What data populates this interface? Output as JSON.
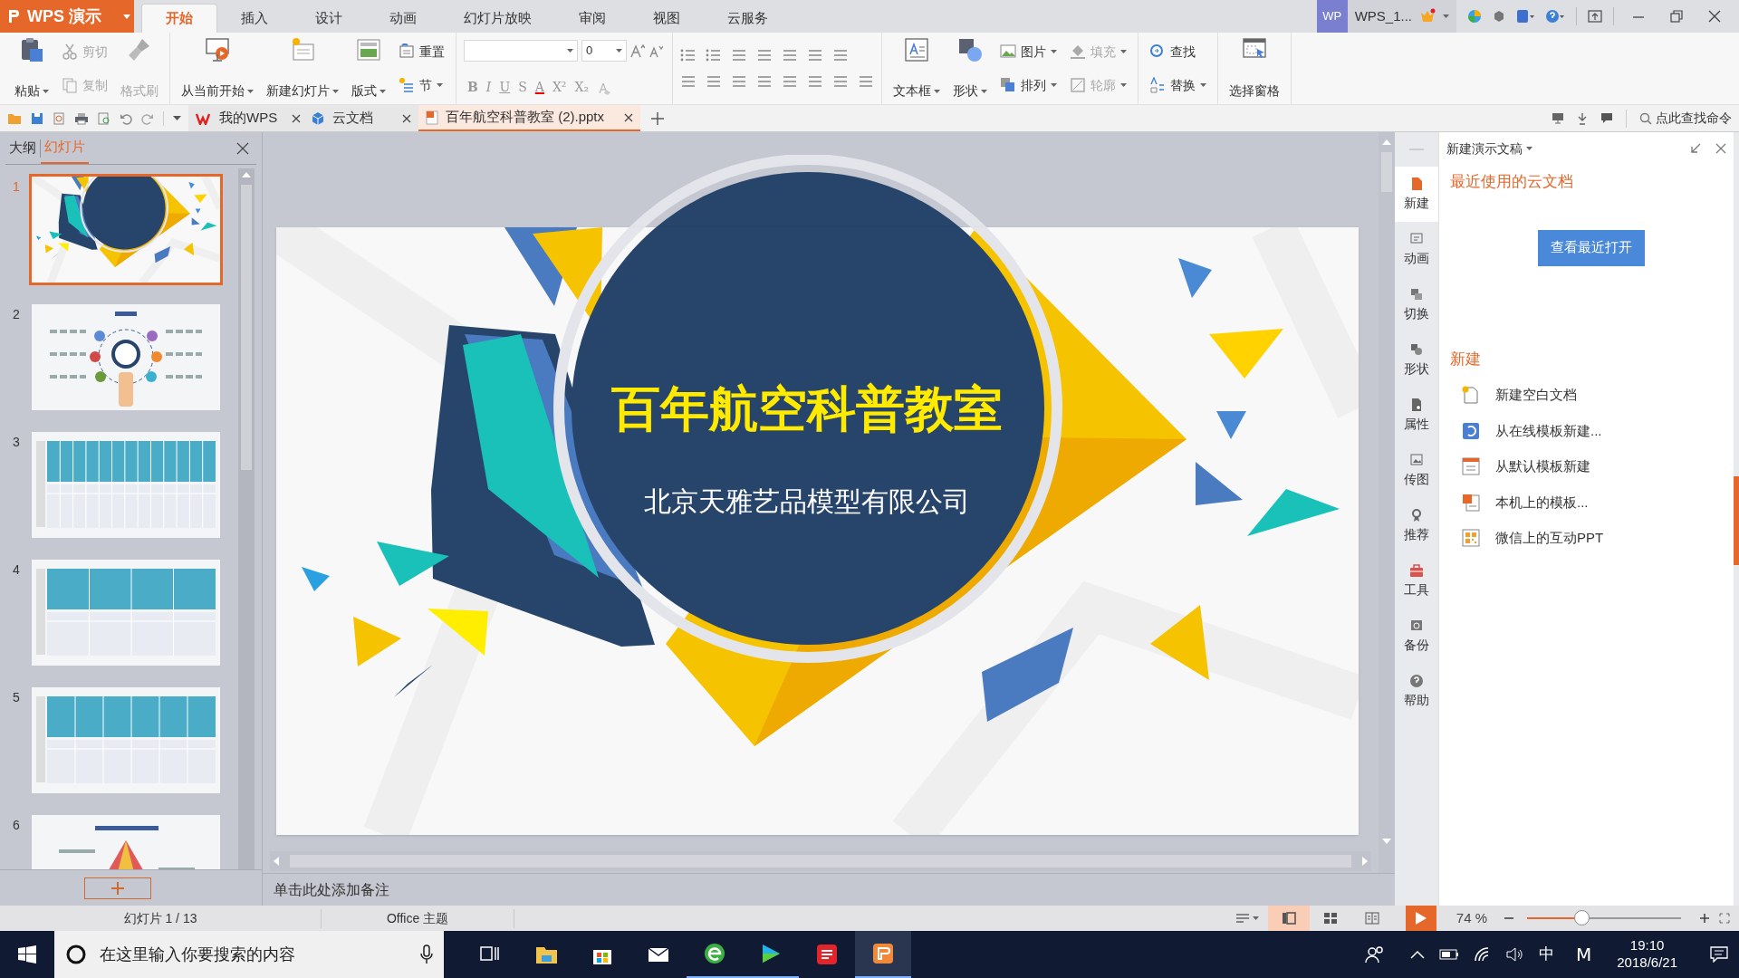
{
  "app": {
    "logo": "WPS 演示",
    "avatar": "WP",
    "account": "WPS_1..."
  },
  "ribbon_tabs": [
    {
      "label": "开始",
      "selected": true
    },
    {
      "label": "插入",
      "selected": false
    },
    {
      "label": "设计",
      "selected": false
    },
    {
      "label": "动画",
      "selected": false
    },
    {
      "label": "幻灯片放映",
      "selected": false
    },
    {
      "label": "审阅",
      "selected": false
    },
    {
      "label": "视图",
      "selected": false
    },
    {
      "label": "云服务",
      "selected": false
    }
  ],
  "ribbon_groups": [
    {
      "kind": "buttons",
      "columns": [
        [
          {
            "kind": "large",
            "label": "粘贴",
            "dropdown": true,
            "disabled": false
          }
        ],
        [
          {
            "kind": "small",
            "label": "剪切",
            "dropdown": false,
            "disabled": true
          },
          {
            "kind": "small",
            "label": "复制",
            "dropdown": false,
            "disabled": true
          }
        ],
        [
          {
            "kind": "large",
            "label": "格式刷",
            "dropdown": false,
            "disabled": true
          }
        ]
      ]
    },
    {
      "kind": "buttons",
      "columns": [
        [
          {
            "kind": "large",
            "label": "从当前开始",
            "dropdown": true,
            "disabled": false
          }
        ],
        [
          {
            "kind": "large",
            "label": "新建幻灯片",
            "dropdown": true,
            "disabled": false
          }
        ],
        [
          {
            "kind": "large",
            "label": "版式",
            "dropdown": true,
            "disabled": false
          }
        ],
        [
          {
            "kind": "small",
            "label": "重置",
            "dropdown": false,
            "disabled": false
          },
          {
            "kind": "small",
            "label": "节",
            "dropdown": true,
            "disabled": false
          }
        ]
      ]
    },
    {
      "kind": "font",
      "font_size": "0",
      "format_buttons": [
        "B",
        "I",
        "U",
        "S",
        "A",
        "X²",
        "X₂"
      ]
    },
    {
      "kind": "paragraph"
    },
    {
      "kind": "buttons",
      "columns": [
        [
          {
            "kind": "large",
            "label": "文本框",
            "dropdown": true,
            "disabled": false
          }
        ],
        [
          {
            "kind": "large",
            "label": "形状",
            "dropdown": true,
            "disabled": false
          }
        ],
        [
          {
            "kind": "small",
            "label": "图片",
            "dropdown": true,
            "disabled": false
          },
          {
            "kind": "small",
            "label": "排列",
            "dropdown": true,
            "disabled": false
          }
        ],
        [
          {
            "kind": "small",
            "label": "填充",
            "dropdown": true,
            "disabled": true
          },
          {
            "kind": "small",
            "label": "轮廓",
            "dropdown": true,
            "disabled": true
          }
        ]
      ]
    },
    {
      "kind": "buttons",
      "columns": [
        [
          {
            "kind": "small",
            "label": "查找",
            "dropdown": false,
            "disabled": false
          },
          {
            "kind": "small",
            "label": "替换",
            "dropdown": true,
            "disabled": false
          }
        ]
      ]
    },
    {
      "kind": "buttons",
      "columns": [
        [
          {
            "kind": "large",
            "label": "选择窗格",
            "dropdown": false,
            "disabled": false
          }
        ]
      ]
    }
  ],
  "doc_tabs": [
    {
      "label": "我的WPS",
      "selected": false
    },
    {
      "label": "云文档",
      "selected": false
    },
    {
      "label": "百年航空科普教室 (2).pptx",
      "selected": true
    }
  ],
  "command_search": {
    "placeholder": "点此查找命令"
  },
  "slides_panel": {
    "tabs": [
      {
        "label": "大纲",
        "selected": false
      },
      {
        "label": "幻灯片",
        "selected": true
      }
    ],
    "slides": [
      {
        "number": "1",
        "selected": true
      },
      {
        "number": "2",
        "selected": false
      },
      {
        "number": "3",
        "selected": false
      },
      {
        "number": "4",
        "selected": false
      },
      {
        "number": "5",
        "selected": false
      },
      {
        "number": "6",
        "selected": false
      }
    ]
  },
  "slide": {
    "title": "百年航空科普教室",
    "subtitle": "北京天雅艺品模型有限公司"
  },
  "notes": {
    "placeholder": "单击此处添加备注"
  },
  "side_tabs": [
    {
      "label": "新建",
      "selected": true
    },
    {
      "label": "动画",
      "selected": false
    },
    {
      "label": "切换",
      "selected": false
    },
    {
      "label": "形状",
      "selected": false
    },
    {
      "label": "属性",
      "selected": false
    },
    {
      "label": "传图",
      "selected": false
    },
    {
      "label": "推荐",
      "selected": false
    },
    {
      "label": "工具",
      "selected": false
    },
    {
      "label": "备份",
      "selected": false
    },
    {
      "label": "帮助",
      "selected": false
    }
  ],
  "task_pane": {
    "title": "新建演示文稿",
    "recent_heading": "最近使用的云文档",
    "recent_button": "查看最近打开",
    "new_heading": "新建",
    "items": [
      "新建空白文档",
      "从在线模板新建...",
      "从默认模板新建",
      "本机上的模板...",
      "微信上的互动PPT"
    ]
  },
  "status_bar": {
    "slide_count": "幻灯片 1 / 13",
    "theme": "Office 主题",
    "views": [
      {
        "selected": true
      },
      {
        "selected": false
      },
      {
        "selected": false
      }
    ],
    "zoom": "74 %",
    "zoom_slider": {
      "level": 0.35
    }
  },
  "taskbar": {
    "search_placeholder": "在这里输入你要搜索的内容",
    "ime": "中",
    "ime_mode": "M",
    "time": "19:10",
    "date": "2018/6/21"
  }
}
